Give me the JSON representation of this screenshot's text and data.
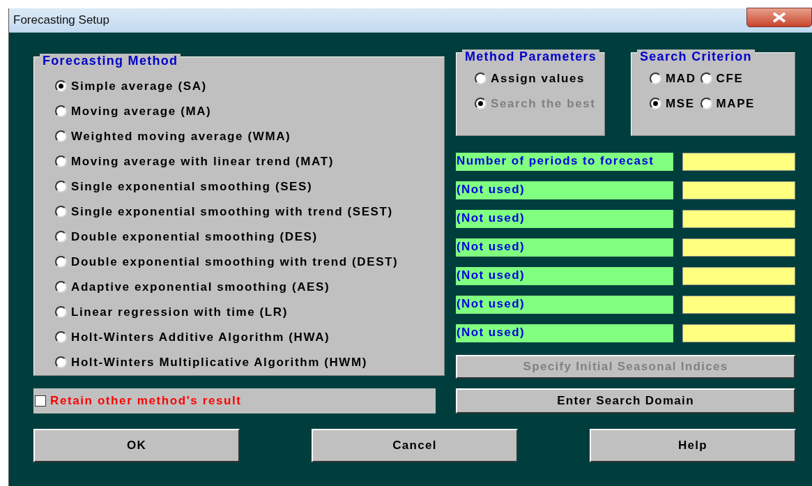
{
  "window": {
    "title": "Forecasting Setup"
  },
  "forecasting_method": {
    "title": "Forecasting Method",
    "options": [
      {
        "label": "Simple average (SA)",
        "selected": true
      },
      {
        "label": "Moving average (MA)",
        "selected": false
      },
      {
        "label": "Weighted moving average (WMA)",
        "selected": false
      },
      {
        "label": "Moving average with linear trend (MAT)",
        "selected": false
      },
      {
        "label": "Single exponential smoothing (SES)",
        "selected": false
      },
      {
        "label": "Single exponential smoothing with trend (SEST)",
        "selected": false
      },
      {
        "label": "Double exponential smoothing (DES)",
        "selected": false
      },
      {
        "label": "Double exponential smoothing with trend (DEST)",
        "selected": false
      },
      {
        "label": "Adaptive exponential smoothing (AES)",
        "selected": false
      },
      {
        "label": "Linear regression with time (LR)",
        "selected": false
      },
      {
        "label": "Holt-Winters Additive Algorithm (HWA)",
        "selected": false
      },
      {
        "label": "Holt-Winters Multiplicative Algorithm (HWM)",
        "selected": false
      }
    ]
  },
  "method_parameters": {
    "title": "Method Parameters",
    "options": [
      {
        "label": "Assign values",
        "selected": false,
        "disabled": false
      },
      {
        "label": "Search the best",
        "selected": true,
        "disabled": true
      }
    ]
  },
  "search_criterion": {
    "title": "Search Criterion",
    "options": [
      {
        "label": "MAD",
        "selected": false
      },
      {
        "label": "CFE",
        "selected": false
      },
      {
        "label": "MSE",
        "selected": true
      },
      {
        "label": "MAPE",
        "selected": false
      }
    ]
  },
  "parameter_fields": [
    {
      "label": "Number of periods to forecast"
    },
    {
      "label": "(Not used)"
    },
    {
      "label": "(Not used)"
    },
    {
      "label": "(Not used)"
    },
    {
      "label": "(Not used)"
    },
    {
      "label": "(Not used)"
    },
    {
      "label": "(Not used)"
    }
  ],
  "side_buttons": [
    {
      "label": "Specify Initial Seasonal Indices",
      "disabled": true
    },
    {
      "label": "Enter Search Domain",
      "disabled": false
    }
  ],
  "retain_checkbox": {
    "label": "Retain other method's result",
    "checked": false
  },
  "buttons": [
    "OK",
    "Cancel",
    "Help"
  ]
}
